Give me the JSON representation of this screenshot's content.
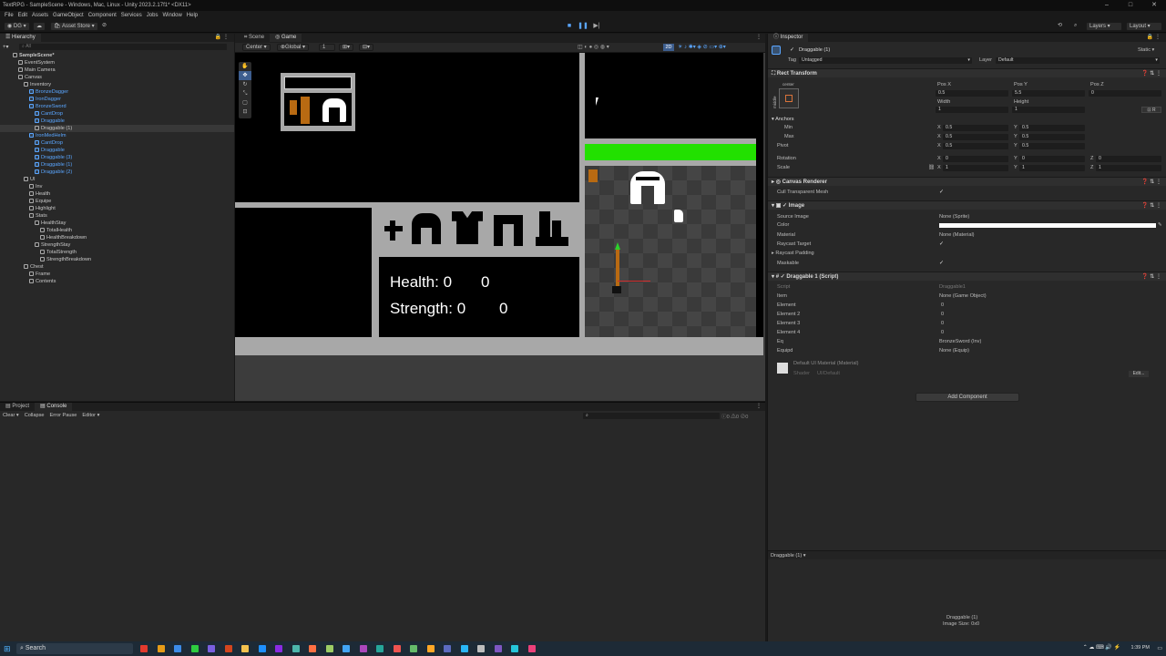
{
  "window": {
    "title": "TextRPG - SampleScene - Windows, Mac, Linux - Unity 2023.2.17f1* <DX11>"
  },
  "menu": [
    "File",
    "Edit",
    "Assets",
    "GameObject",
    "Component",
    "Services",
    "Jobs",
    "Window",
    "Help"
  ],
  "toolbar": {
    "account": "DG",
    "asset_store": "Asset Store",
    "layers": "Layers",
    "layout": "Layout"
  },
  "hierarchy": {
    "tab": "Hierarchy",
    "search_placeholder": "All",
    "items": [
      {
        "label": "SampleScene*",
        "indent": 0,
        "blue": false,
        "bold": true
      },
      {
        "label": "EventSystem",
        "indent": 1,
        "blue": false
      },
      {
        "label": "Main Camera",
        "indent": 1,
        "blue": false
      },
      {
        "label": "Canvas",
        "indent": 1,
        "blue": false
      },
      {
        "label": "Inventory",
        "indent": 2,
        "blue": false
      },
      {
        "label": "BronzeDagger",
        "indent": 3,
        "blue": true
      },
      {
        "label": "IronDagger",
        "indent": 3,
        "blue": true
      },
      {
        "label": "BronzeSword",
        "indent": 3,
        "blue": true
      },
      {
        "label": "CantDrop",
        "indent": 4,
        "blue": true
      },
      {
        "label": "Draggable",
        "indent": 4,
        "blue": true
      },
      {
        "label": "Draggable (1)",
        "indent": 4,
        "blue": false,
        "selected": true
      },
      {
        "label": "IronMedHelm",
        "indent": 3,
        "blue": true
      },
      {
        "label": "CantDrop",
        "indent": 4,
        "blue": true
      },
      {
        "label": "Draggable",
        "indent": 4,
        "blue": true
      },
      {
        "label": "Draggable (3)",
        "indent": 4,
        "blue": true
      },
      {
        "label": "Draggable (1)",
        "indent": 4,
        "blue": true
      },
      {
        "label": "Draggable (2)",
        "indent": 4,
        "blue": true
      },
      {
        "label": "UI",
        "indent": 2,
        "blue": false
      },
      {
        "label": "Inv",
        "indent": 3,
        "blue": false
      },
      {
        "label": "Health",
        "indent": 3,
        "blue": false
      },
      {
        "label": "Equipe",
        "indent": 3,
        "blue": false
      },
      {
        "label": "Highlight",
        "indent": 3,
        "blue": false
      },
      {
        "label": "Stats",
        "indent": 3,
        "blue": false
      },
      {
        "label": "HealthStay",
        "indent": 4,
        "blue": false
      },
      {
        "label": "TotalHealth",
        "indent": 5,
        "blue": false
      },
      {
        "label": "HealthBreakdown",
        "indent": 5,
        "blue": false
      },
      {
        "label": "StrengthStay",
        "indent": 4,
        "blue": false
      },
      {
        "label": "TotalStrength",
        "indent": 5,
        "blue": false
      },
      {
        "label": "StrengthBreakdown",
        "indent": 5,
        "blue": false
      },
      {
        "label": "Chest",
        "indent": 2,
        "blue": false
      },
      {
        "label": "Frame",
        "indent": 3,
        "blue": false
      },
      {
        "label": "Contents",
        "indent": 3,
        "blue": false
      }
    ]
  },
  "view": {
    "tabs": [
      "Scene",
      "Game"
    ],
    "pivot": "Center",
    "space": "Global",
    "grid_value": "1",
    "mode_2d": "2D"
  },
  "game": {
    "health_label": "Health: 0",
    "health_value": "0",
    "strength_label": "Strength: 0",
    "strength_value": "0",
    "health_bar_fraction": 1.0,
    "colors": {
      "health_bar": "#22e000",
      "item_orange": "#b86a12",
      "white": "#ffffff"
    }
  },
  "bottom": {
    "tabs": [
      "Project",
      "Console"
    ],
    "console_buttons": [
      "Clear",
      "Collapse",
      "Error Pause",
      "Editor"
    ],
    "counts": [
      "0",
      "0",
      "0"
    ]
  },
  "inspector": {
    "tab": "Inspector",
    "object_name": "Draggable (1)",
    "static_label": "Static",
    "tag_label": "Tag",
    "tag_value": "Untagged",
    "layer_label": "Layer",
    "layer_value": "Default",
    "rect_transform": "Rect Transform",
    "anchor_preset": "center",
    "anchor_preset_side": "middle",
    "pos_x_label": "Pos X",
    "pos_x": "0.5",
    "pos_y_label": "Pos Y",
    "pos_y": "5.5",
    "pos_z_label": "Pos Z",
    "pos_z": "0",
    "width_label": "Width",
    "width": "1",
    "height_label": "Height",
    "height": "1",
    "anchors_label": "Anchors",
    "min_label": "Min",
    "min_x": "0.5",
    "min_y": "0.5",
    "max_label": "Max",
    "max_x": "0.5",
    "max_y": "0.5",
    "pivot_label": "Pivot",
    "pivot_x": "0.5",
    "pivot_y": "0.5",
    "rotation_label": "Rotation",
    "rot_x": "0",
    "rot_y": "0",
    "rot_z": "0",
    "scale_label": "Scale",
    "scale_x": "1",
    "scale_y": "1",
    "scale_z": "1",
    "axis_x": "X",
    "axis_y": "Y",
    "axis_z": "Z",
    "canvas_renderer": "Canvas Renderer",
    "cull_label": "Cull Transparent Mesh",
    "image_header": "Image",
    "source_image_label": "Source Image",
    "source_image": "None (Sprite)",
    "color_label": "Color",
    "material_label": "Material",
    "material": "None (Material)",
    "raycast_target_label": "Raycast Target",
    "raycast_padding_label": "Raycast Padding",
    "maskable_label": "Maskable",
    "script_header": "Draggable 1 (Script)",
    "script_label": "Script",
    "script_value": "Draggable1",
    "item_label": "Item",
    "item_value": "None (Game Object)",
    "element_labels": [
      "Element",
      "Element 2",
      "Element 3",
      "Element 4"
    ],
    "element_values": [
      "0",
      "0",
      "0",
      "0"
    ],
    "eq_label": "Eq",
    "eq_value": "BronzeSword (Inv)",
    "equipd_label": "Equipd",
    "equipd_value": "None (Equip)",
    "material_asset": "Default UI Material (Material)",
    "shader_label": "Shader",
    "shader_value": "UI/Default",
    "edit_label": "Edit...",
    "add_component": "Add Component",
    "preview_header": "Draggable (1)",
    "preview_name": "Draggable (1)",
    "preview_size": "Image Size: 0x0"
  },
  "taskbar": {
    "search": "Search",
    "time": "1:39 PM"
  }
}
